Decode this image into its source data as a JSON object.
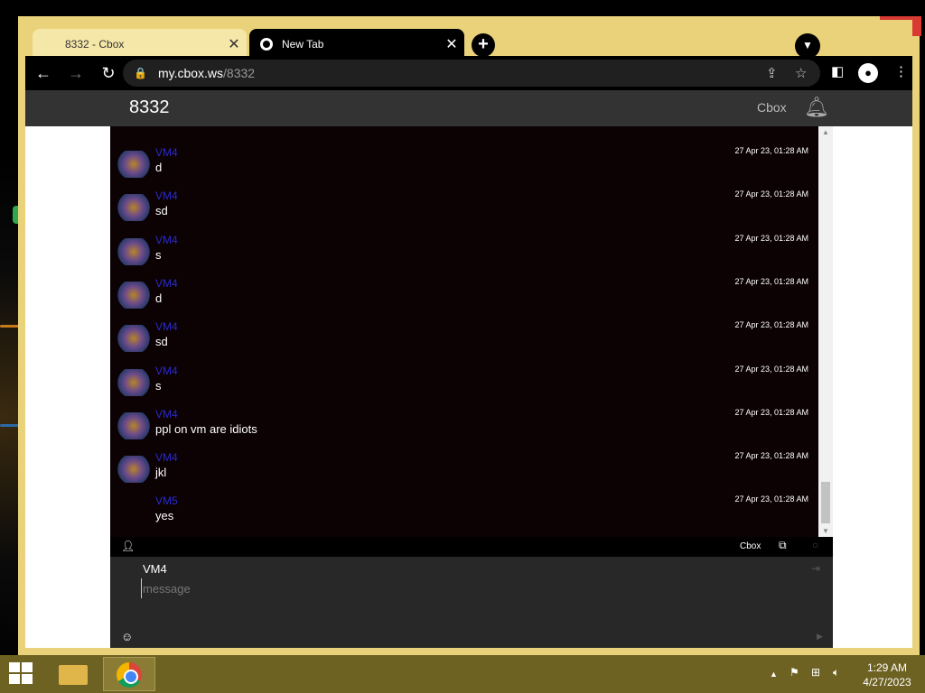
{
  "browser": {
    "tabs": [
      {
        "title": "8332 - Cbox",
        "active": false
      },
      {
        "title": "New Tab",
        "active": true
      }
    ],
    "address": {
      "host": "my.cbox.ws",
      "path": "/8332"
    }
  },
  "cbox": {
    "room_title": "8332",
    "brand": "Cbox",
    "messages": [
      {
        "name": "VM4",
        "text": "d",
        "time": "27 Apr 23, 01:28 AM",
        "has_avatar": true
      },
      {
        "name": "VM4",
        "text": "sd",
        "time": "27 Apr 23, 01:28 AM",
        "has_avatar": true
      },
      {
        "name": "VM4",
        "text": "s",
        "time": "27 Apr 23, 01:28 AM",
        "has_avatar": true
      },
      {
        "name": "VM4",
        "text": "d",
        "time": "27 Apr 23, 01:28 AM",
        "has_avatar": true
      },
      {
        "name": "VM4",
        "text": "sd",
        "time": "27 Apr 23, 01:28 AM",
        "has_avatar": true
      },
      {
        "name": "VM4",
        "text": "s",
        "time": "27 Apr 23, 01:28 AM",
        "has_avatar": true
      },
      {
        "name": "VM4",
        "text": "ppl on vm are idiots",
        "time": "27 Apr 23, 01:28 AM",
        "has_avatar": true
      },
      {
        "name": "VM4",
        "text": "jkl",
        "time": "27 Apr 23, 01:28 AM",
        "has_avatar": true
      },
      {
        "name": "VM5",
        "text": "yes",
        "time": "27 Apr 23, 01:28 AM",
        "has_avatar": false
      }
    ],
    "footer_brand": "Cbox",
    "compose": {
      "username": "VM4",
      "placeholder": "message"
    }
  },
  "taskbar": {
    "time": "1:29 AM",
    "date": "4/27/2023"
  }
}
